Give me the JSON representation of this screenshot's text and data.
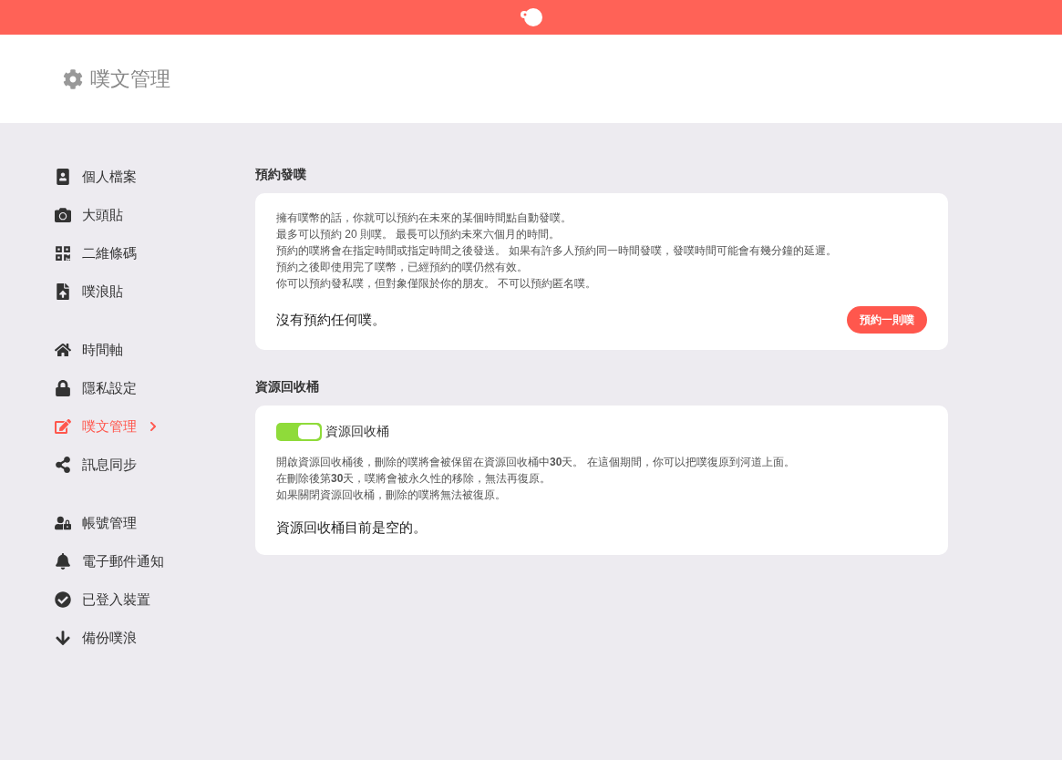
{
  "header": {
    "title": "噗文管理"
  },
  "sidebar": {
    "groups": [
      {
        "items": [
          {
            "label": "個人檔案",
            "selected": false
          },
          {
            "label": "大頭貼",
            "selected": false
          },
          {
            "label": "二維條碼",
            "selected": false
          },
          {
            "label": "噗浪貼",
            "selected": false
          }
        ]
      },
      {
        "items": [
          {
            "label": "時間軸",
            "selected": false
          },
          {
            "label": "隱私設定",
            "selected": false
          },
          {
            "label": "噗文管理",
            "selected": true
          },
          {
            "label": "訊息同步",
            "selected": false
          }
        ]
      },
      {
        "items": [
          {
            "label": "帳號管理",
            "selected": false
          },
          {
            "label": "電子郵件通知",
            "selected": false
          },
          {
            "label": "已登入裝置",
            "selected": false
          },
          {
            "label": "備份噗浪",
            "selected": false
          }
        ]
      }
    ]
  },
  "sections": [
    {
      "title": "預約發噗",
      "description": [
        "擁有噗幣的話，你就可以預約在未來的某個時間點自動發噗。",
        "最多可以預約 20 則噗。 最長可以預約未來六個月的時間。",
        "預約的噗將會在指定時間或指定時間之後發送。 如果有許多人預約同一時間發噗，發噗時間可能會有幾分鐘的延遲。",
        "預約之後即使用完了噗幣，已經預約的噗仍然有效。",
        "你可以預約發私噗，但對象僅限於你的朋友。 不可以預約匿名噗。"
      ],
      "status": "沒有預約任何噗。",
      "button": "預約一則噗"
    },
    {
      "title": "資源回收桶",
      "toggle": {
        "label": "資源回收桶",
        "on": true
      },
      "description": [
        "開啟資源回收桶後，刪除的噗將會被保留在資源回收桶中**30**天。 在這個期間，你可以把噗復原到河道上面。",
        "在刪除後第**30**天，噗將會被永久性的移除，無法再復原。",
        "如果關閉資源回收桶，刪除的噗將無法被復原。"
      ],
      "status": "資源回收桶目前是空的。"
    }
  ]
}
